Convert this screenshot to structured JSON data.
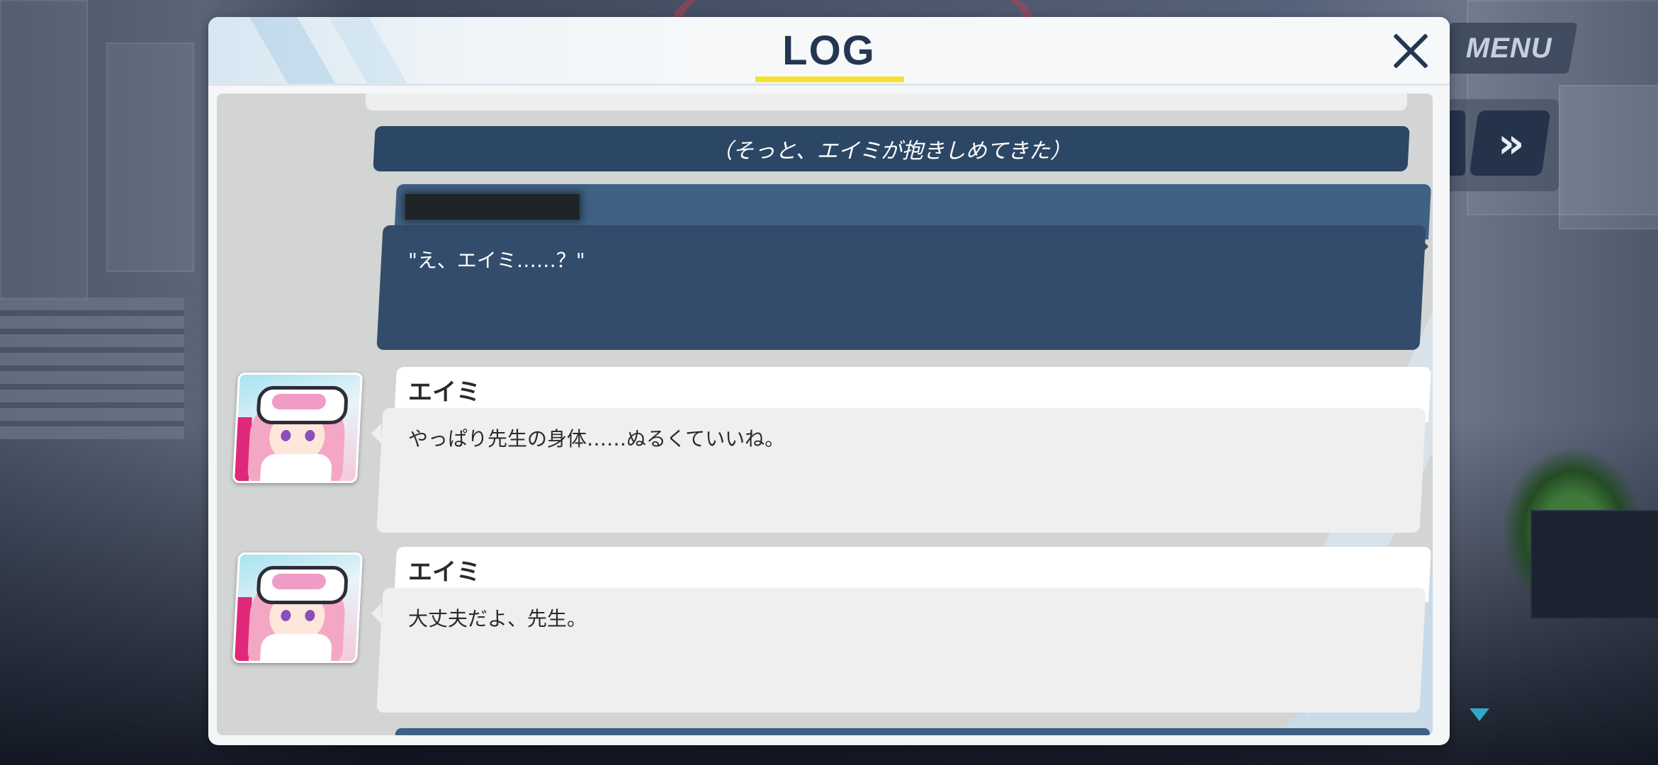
{
  "hud": {
    "menu_label": "MENU",
    "skip_icon": "double-chevron-right-icon"
  },
  "log": {
    "title": "LOG",
    "close_icon": "close-icon",
    "narration": "（そっと、エイミが抱きしめてきた）",
    "entries": [
      {
        "speaker": "",
        "speaker_redacted": true,
        "text": "\"え、エイミ……？\"",
        "style": "player"
      },
      {
        "speaker": "エイミ",
        "text": "やっぱり先生の身体……ぬるくていいね。",
        "style": "npc",
        "portrait": "eimi-portrait"
      },
      {
        "speaker": "エイミ",
        "text": "大丈夫だよ、先生。",
        "style": "npc",
        "portrait": "eimi-portrait"
      }
    ]
  },
  "colors": {
    "title_text": "#243650",
    "title_underline": "#f5e12f",
    "narration_bg": "#2c4765",
    "player_name_bar": "#3f6183",
    "player_text_bg": "#334c6b",
    "npc_text_bg": "#efefef",
    "log_body_bg": "#d3d4d4"
  }
}
